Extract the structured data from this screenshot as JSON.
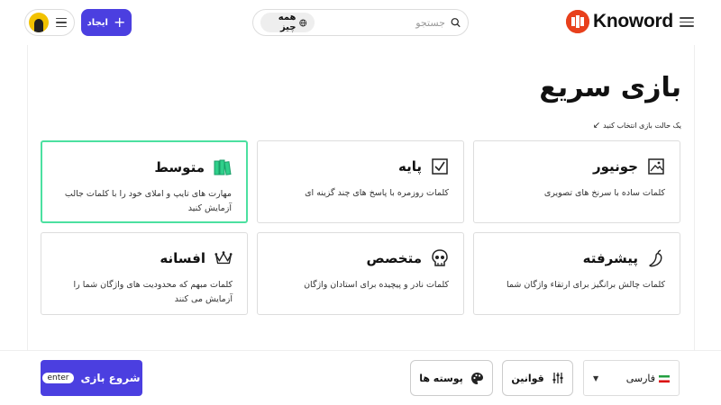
{
  "header": {
    "logo_text": "Knoword",
    "search": {
      "placeholder": "جستجو",
      "scope_label": "همه چیز"
    },
    "create_label": "ایجاد"
  },
  "main": {
    "title": "بازی سریع",
    "hint": "یک حالت بازی انتخاب کنید",
    "modes": [
      {
        "title": "جونیور",
        "desc": "کلمات ساده با سرنخ های تصویری",
        "icon": "image-icon"
      },
      {
        "title": "پایه",
        "desc": "کلمات روزمره با پاسخ های چند گزینه ای",
        "icon": "checkbox-icon"
      },
      {
        "title": "متوسط",
        "desc": "مهارت های تایپ و املای خود را با کلمات جالب آزمایش کنید",
        "icon": "books-icon",
        "selected": true
      },
      {
        "title": "پیشرفته",
        "desc": "کلمات چالش برانگیز برای ارتقاء واژگان شما",
        "icon": "pepper-icon"
      },
      {
        "title": "متخصص",
        "desc": "کلمات نادر و پیچیده برای استادان واژگان",
        "icon": "skull-icon"
      },
      {
        "title": "افسانه",
        "desc": "کلمات مبهم که محدودیت های واژگان شما را آزمایش می کنند",
        "icon": "crown-icon"
      }
    ]
  },
  "footer": {
    "language": "فارسی",
    "rules_label": "قوانین",
    "skins_label": "پوسته ها",
    "start_label": "شروع بازی",
    "enter_badge": "enter"
  },
  "colors": {
    "accent": "#4b3fe0",
    "selected_border": "#4ce0a0",
    "selected_icon": "#2fcf8a",
    "logo": "#e8401c"
  }
}
